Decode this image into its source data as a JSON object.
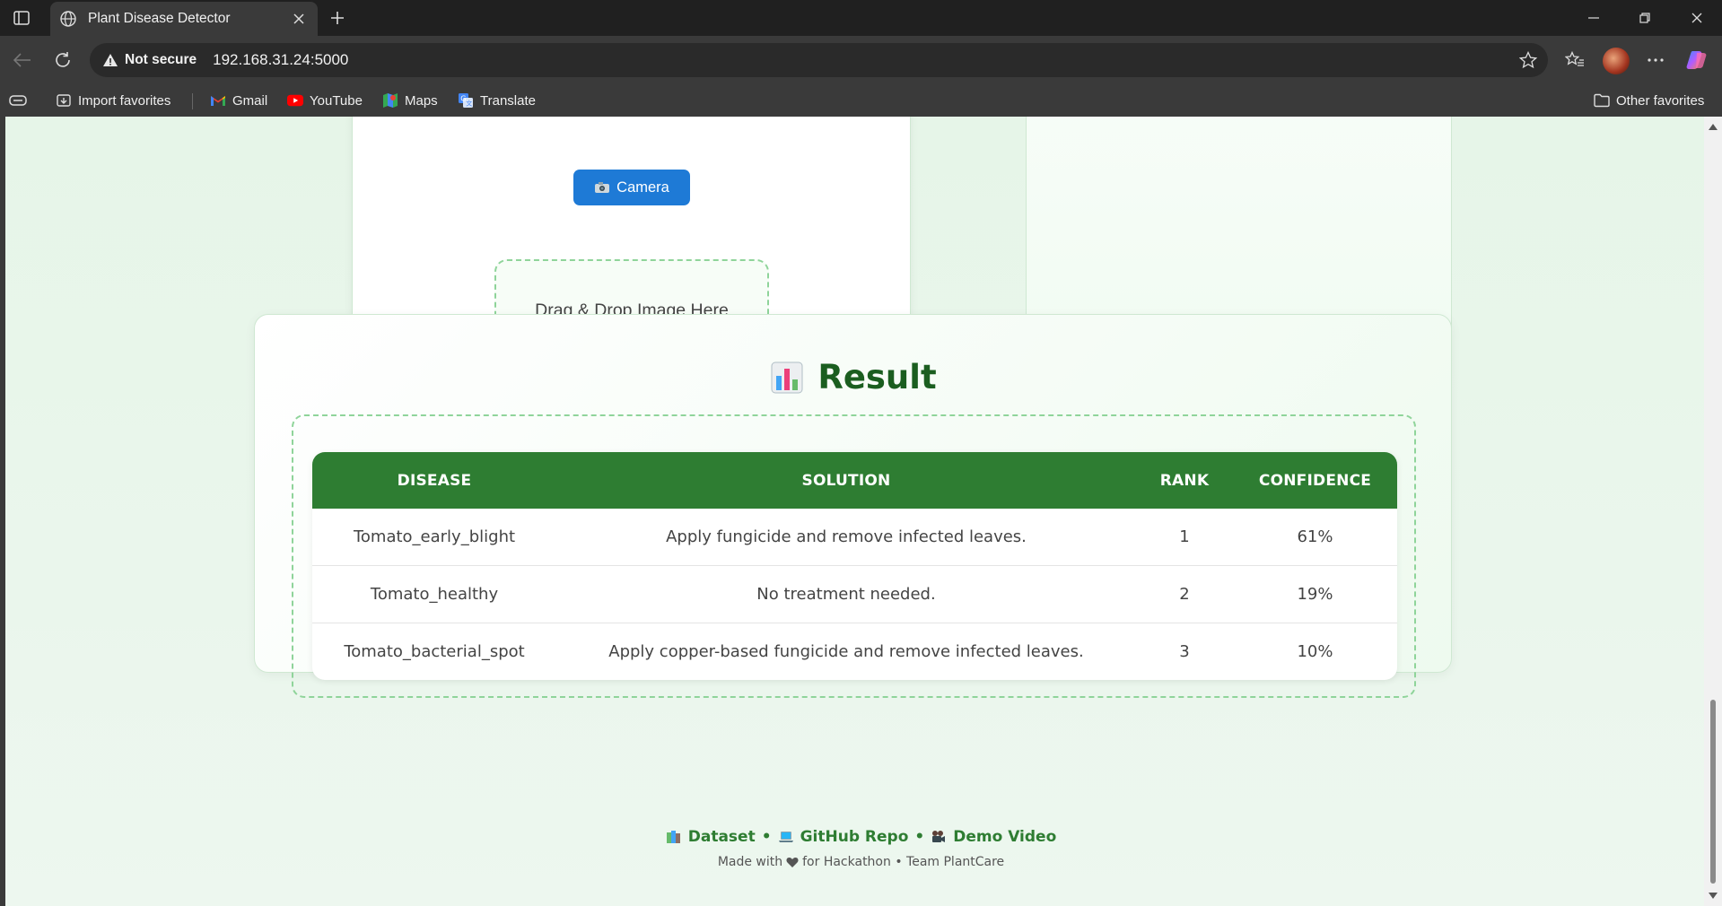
{
  "browser": {
    "tab_title": "Plant Disease Detector",
    "security_label": "Not secure",
    "url": "192.168.31.24:5000",
    "bookmarks": [
      {
        "label": "Import favorites",
        "icon": "import-favorites-icon"
      },
      {
        "label": "Gmail",
        "icon": "gmail-icon"
      },
      {
        "label": "YouTube",
        "icon": "youtube-icon"
      },
      {
        "label": "Maps",
        "icon": "maps-icon"
      },
      {
        "label": "Translate",
        "icon": "translate-icon"
      }
    ],
    "other_favorites": "Other favorites"
  },
  "upload": {
    "camera_label": "Camera",
    "dropzone_text": "Drag & Drop Image Here"
  },
  "result": {
    "title": "Result",
    "columns": [
      "Disease",
      "Solution",
      "Rank",
      "Confidence"
    ],
    "rows": [
      {
        "disease": "Tomato_early_blight",
        "solution": "Apply fungicide and remove infected leaves.",
        "rank": "1",
        "confidence": "61%"
      },
      {
        "disease": "Tomato_healthy",
        "solution": "No treatment needed.",
        "rank": "2",
        "confidence": "19%"
      },
      {
        "disease": "Tomato_bacterial_spot",
        "solution": "Apply copper-based fungicide and remove infected leaves.",
        "rank": "3",
        "confidence": "10%"
      }
    ]
  },
  "footer": {
    "links": [
      {
        "label": "Dataset",
        "icon": "books-icon"
      },
      {
        "label": "GitHub Repo",
        "icon": "laptop-icon"
      },
      {
        "label": "Demo Video",
        "icon": "video-camera-icon"
      }
    ],
    "separator": "•",
    "note_prefix": "Made with",
    "note_suffix": "for Hackathon • Team PlantCare"
  },
  "colors": {
    "accent": "#2e7d32",
    "title": "#1b5e20",
    "camera_button": "#1e7ad6",
    "dashed_border": "#8fd49a"
  }
}
